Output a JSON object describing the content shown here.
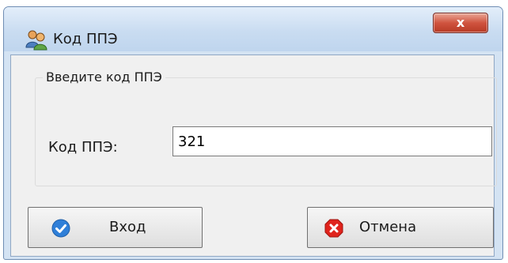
{
  "window": {
    "title": "Код ППЭ",
    "close_label": "x"
  },
  "group": {
    "legend": "Введите код ППЭ"
  },
  "form": {
    "code_label": "Код ППЭ:",
    "code_value": "321"
  },
  "buttons": {
    "login_label": "Вход",
    "cancel_label": "Отмена"
  },
  "icons": {
    "app": "users-icon",
    "login": "checkmark-icon",
    "cancel": "stop-x-icon"
  },
  "colors": {
    "login_icon": "#2f7fd8",
    "cancel_icon": "#e0231c",
    "close_button": "#c94632"
  }
}
